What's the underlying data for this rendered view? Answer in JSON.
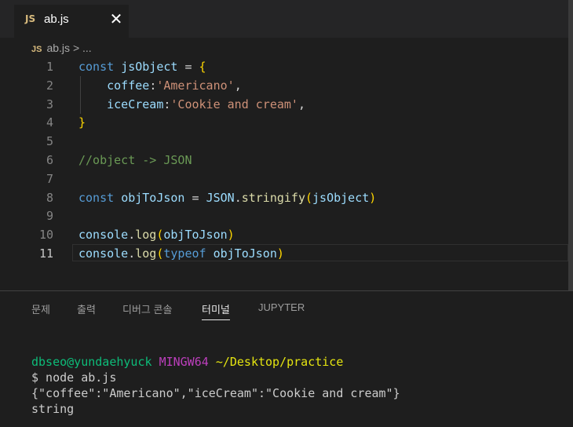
{
  "tab": {
    "icon": "JS",
    "filename": "ab.js",
    "close_glyph": "✕"
  },
  "breadcrumb": {
    "icon": "JS",
    "file": "ab.js",
    "separator": ">",
    "more": "..."
  },
  "editor": {
    "line_numbers": [
      "1",
      "2",
      "3",
      "4",
      "5",
      "6",
      "7",
      "8",
      "9",
      "10",
      "11"
    ],
    "lines": [
      [
        {
          "t": "const ",
          "c": "kw"
        },
        {
          "t": "jsObject",
          "c": "var"
        },
        {
          "t": " = ",
          "c": "op"
        },
        {
          "t": "{",
          "c": "br1"
        }
      ],
      [
        {
          "t": "    coffee",
          "c": "prop"
        },
        {
          "t": ":",
          "c": "op"
        },
        {
          "t": "'Americano'",
          "c": "str"
        },
        {
          "t": ",",
          "c": "op"
        }
      ],
      [
        {
          "t": "    iceCream",
          "c": "prop"
        },
        {
          "t": ":",
          "c": "op"
        },
        {
          "t": "'Cookie and cream'",
          "c": "str"
        },
        {
          "t": ",",
          "c": "op"
        }
      ],
      [
        {
          "t": "}",
          "c": "br1"
        }
      ],
      [],
      [
        {
          "t": "//object -> JSON",
          "c": "cm"
        }
      ],
      [],
      [
        {
          "t": "const ",
          "c": "kw"
        },
        {
          "t": "objToJson",
          "c": "var"
        },
        {
          "t": " = ",
          "c": "op"
        },
        {
          "t": "JSON",
          "c": "var"
        },
        {
          "t": ".",
          "c": "op"
        },
        {
          "t": "stringify",
          "c": "fn"
        },
        {
          "t": "(",
          "c": "br1"
        },
        {
          "t": "jsObject",
          "c": "var"
        },
        {
          "t": ")",
          "c": "br1"
        }
      ],
      [],
      [
        {
          "t": "console",
          "c": "var"
        },
        {
          "t": ".",
          "c": "op"
        },
        {
          "t": "log",
          "c": "fn"
        },
        {
          "t": "(",
          "c": "br1"
        },
        {
          "t": "objToJson",
          "c": "var"
        },
        {
          "t": ")",
          "c": "br1"
        }
      ],
      [
        {
          "t": "console",
          "c": "var"
        },
        {
          "t": ".",
          "c": "op"
        },
        {
          "t": "log",
          "c": "fn"
        },
        {
          "t": "(",
          "c": "br1"
        },
        {
          "t": "typeof ",
          "c": "kw"
        },
        {
          "t": "objToJson",
          "c": "var"
        },
        {
          "t": ")",
          "c": "br1"
        }
      ]
    ],
    "active_line": "11"
  },
  "panel": {
    "tabs": [
      "문제",
      "출력",
      "디버그 콘솔",
      "터미널",
      "JUPYTER"
    ],
    "active_tab": "터미널"
  },
  "terminal": {
    "user": "dbseo@yundaehyuck",
    "env": "MINGW64",
    "path": "~/Desktop/practice",
    "command": "$ node ab.js",
    "output_1": "{\"coffee\":\"Americano\",\"iceCream\":\"Cookie and cream\"}",
    "output_2": "string"
  }
}
